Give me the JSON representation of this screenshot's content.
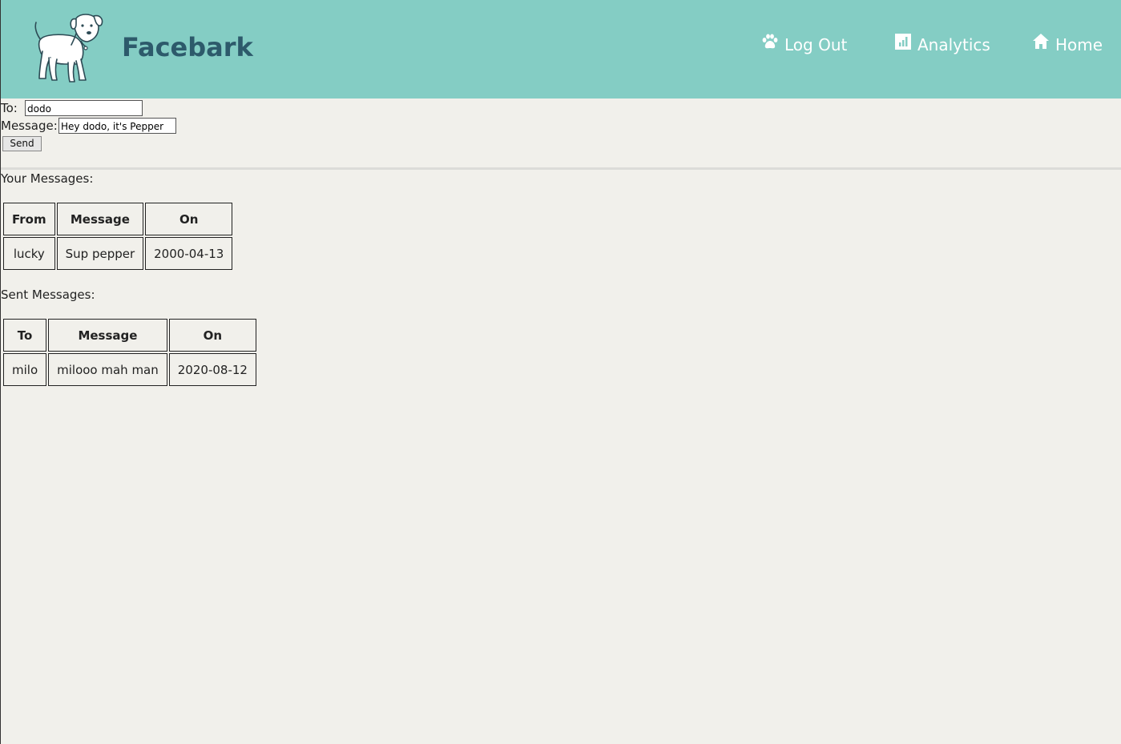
{
  "header": {
    "brand": "Facebark",
    "nav": [
      {
        "label": "Log Out",
        "icon": "paw-icon"
      },
      {
        "label": "Analytics",
        "icon": "bar-chart-icon"
      },
      {
        "label": "Home",
        "icon": "home-icon"
      }
    ],
    "colors": {
      "background": "#84cdc4",
      "brand": "#2d5a6b",
      "nav_text": "#ffffff"
    }
  },
  "compose": {
    "to_label": "To:",
    "to_value": "dodo",
    "message_label": "Message:",
    "message_value": "Hey dodo, it's Pepper",
    "send_label": "Send"
  },
  "received": {
    "title": "Your Messages:",
    "columns": [
      "From",
      "Message",
      "On"
    ],
    "rows": [
      [
        "lucky",
        "Sup pepper",
        "2000-04-13"
      ]
    ]
  },
  "sent": {
    "title": "Sent Messages:",
    "columns": [
      "To",
      "Message",
      "On"
    ],
    "rows": [
      [
        "milo",
        "milooo mah man",
        "2020-08-12"
      ]
    ]
  }
}
